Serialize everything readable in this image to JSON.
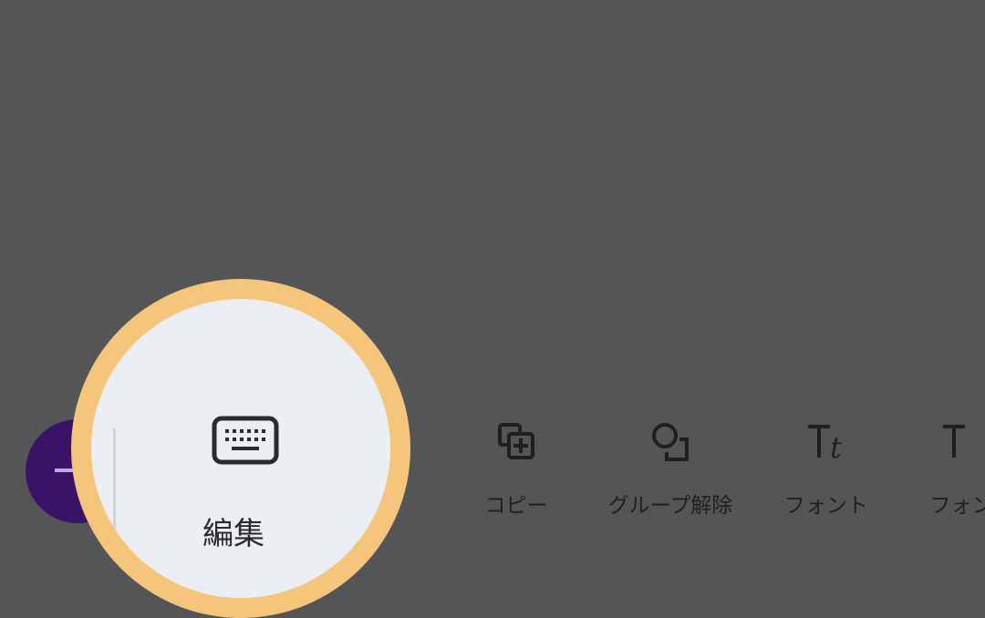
{
  "toolbar": {
    "edit_label": "編集",
    "copy_label": "コピー",
    "ungroup_label": "グループ解除",
    "font_label": "フォント",
    "font2_label": "フォン"
  }
}
